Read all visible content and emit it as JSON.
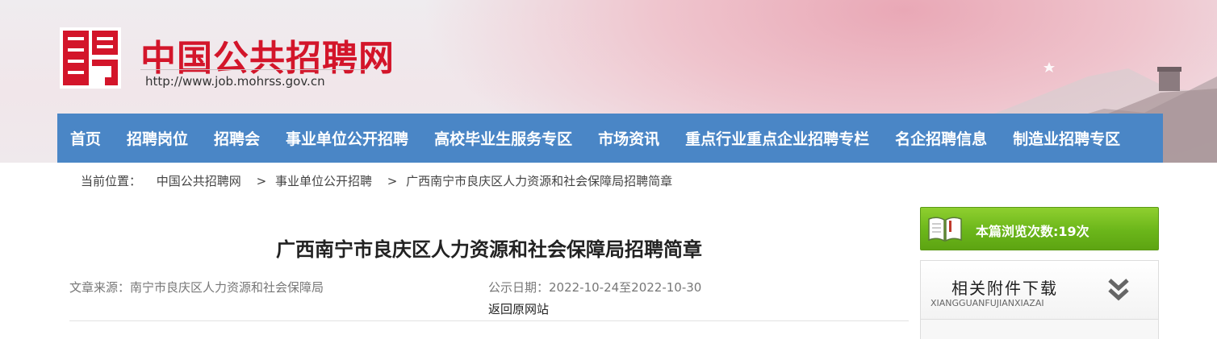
{
  "header": {
    "site_title": "中国公共招聘网",
    "site_url": "http://www.job.mohrss.gov.cn",
    "colors": {
      "brand_red": "#d3152a",
      "nav_blue": "#4a86c6"
    }
  },
  "nav": {
    "items": [
      {
        "label": "首页"
      },
      {
        "label": "招聘岗位"
      },
      {
        "label": "招聘会"
      },
      {
        "label": "事业单位公开招聘"
      },
      {
        "label": "高校毕业生服务专区"
      },
      {
        "label": "市场资讯"
      },
      {
        "label": "重点行业重点企业招聘专栏"
      },
      {
        "label": "名企招聘信息"
      },
      {
        "label": "制造业招聘专区"
      }
    ]
  },
  "breadcrumb": {
    "prefix": "当前位置：",
    "items": [
      "中国公共招聘网",
      "事业单位公开招聘",
      "广西南宁市良庆区人力资源和社会保障局招聘简章"
    ],
    "separator": ">"
  },
  "article": {
    "title": "广西南宁市良庆区人力资源和社会保障局招聘简章",
    "source": "文章来源：南宁市良庆区人力资源和社会保障局",
    "date": "公示日期：2022-10-24至2022-10-30",
    "back_link": "返回原网站"
  },
  "sidebar": {
    "views": {
      "text": "本篇浏览次数:19次",
      "icon": "book-icon",
      "color": "#6bb61a"
    },
    "attachments": {
      "title": "相关附件下载",
      "subtitle": "XIANGGUANFUJIANXIAZAI",
      "icon": "double-chevron-down-icon"
    }
  }
}
